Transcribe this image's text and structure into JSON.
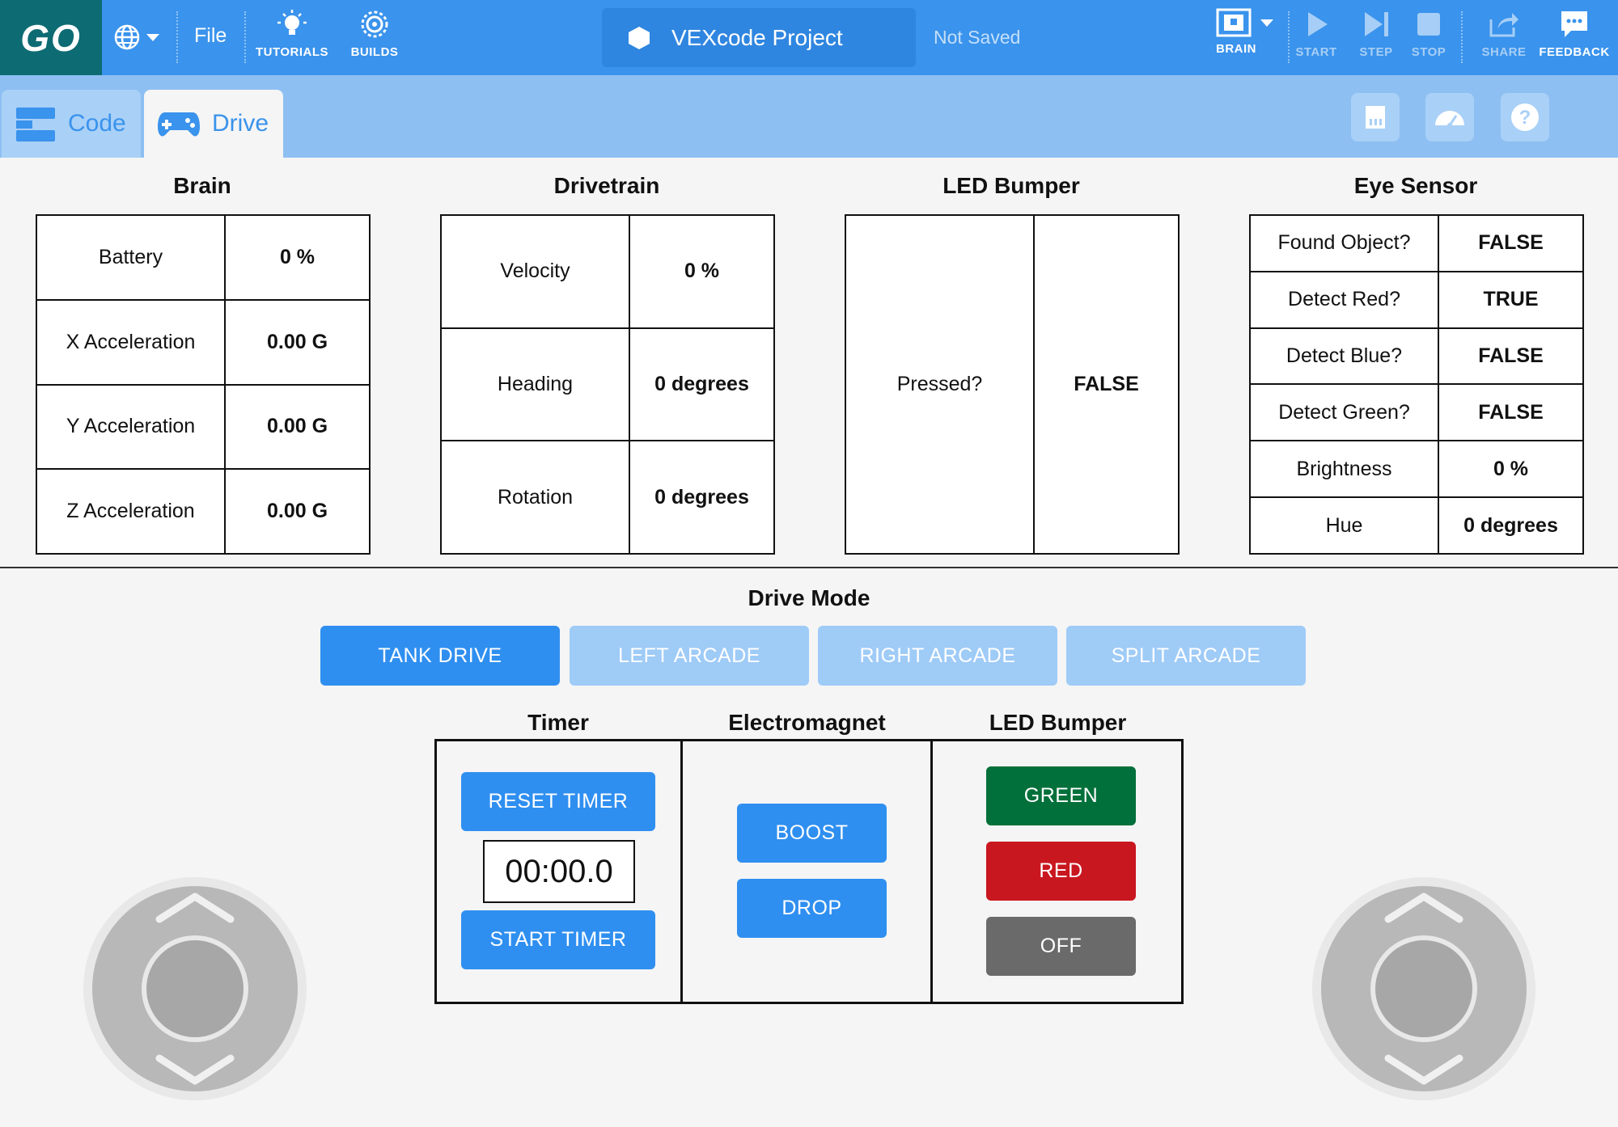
{
  "header": {
    "logo": "GO",
    "file_label": "File",
    "tutorials_label": "TUTORIALS",
    "builds_label": "BUILDS",
    "project_name": "VEXcode Project",
    "save_status": "Not Saved",
    "brain_label": "BRAIN",
    "start_label": "START",
    "step_label": "STEP",
    "stop_label": "STOP",
    "share_label": "SHARE",
    "feedback_label": "FEEDBACK"
  },
  "tabs": [
    {
      "label": "Code",
      "icon": "code-blocks-icon"
    },
    {
      "label": "Drive",
      "icon": "gamepad-icon",
      "active": true
    }
  ],
  "panels": {
    "brain": {
      "title": "Brain",
      "rows": [
        {
          "label": "Battery",
          "value": "0 %"
        },
        {
          "label": "X Acceleration",
          "value": "0.00 G"
        },
        {
          "label": "Y Acceleration",
          "value": "0.00 G"
        },
        {
          "label": "Z Acceleration",
          "value": "0.00 G"
        }
      ]
    },
    "drivetrain": {
      "title": "Drivetrain",
      "rows": [
        {
          "label": "Velocity",
          "value": "0 %"
        },
        {
          "label": "Heading",
          "value": "0 degrees"
        },
        {
          "label": "Rotation",
          "value": "0 degrees"
        }
      ]
    },
    "led_bumper": {
      "title": "LED Bumper",
      "rows": [
        {
          "label": "Pressed?",
          "value": "FALSE"
        }
      ]
    },
    "eye_sensor": {
      "title": "Eye Sensor",
      "rows": [
        {
          "label": "Found Object?",
          "value": "FALSE"
        },
        {
          "label": "Detect Red?",
          "value": "TRUE"
        },
        {
          "label": "Detect Blue?",
          "value": "FALSE"
        },
        {
          "label": "Detect Green?",
          "value": "FALSE"
        },
        {
          "label": "Brightness",
          "value": "0 %"
        },
        {
          "label": "Hue",
          "value": "0 degrees"
        }
      ]
    }
  },
  "drive_mode": {
    "title": "Drive Mode",
    "options": [
      "TANK DRIVE",
      "LEFT ARCADE",
      "RIGHT ARCADE",
      "SPLIT ARCADE"
    ],
    "selected": "TANK DRIVE"
  },
  "controls": {
    "timer": {
      "title": "Timer",
      "reset_label": "RESET TIMER",
      "display": "00:00.0",
      "start_label": "START TIMER"
    },
    "electromagnet": {
      "title": "Electromagnet",
      "boost_label": "BOOST",
      "drop_label": "DROP"
    },
    "led_bumper": {
      "title": "LED Bumper",
      "green_label": "GREEN",
      "red_label": "RED",
      "off_label": "OFF"
    }
  },
  "colors": {
    "topbar": "#3a93ec",
    "logo_bg": "#0d6b73",
    "tabbar": "#8ebff2",
    "button_blue": "#2f8ff0",
    "button_inactive": "#9fcbf7",
    "led_green": "#02703a",
    "led_red": "#c9171f",
    "led_off": "#6a6a6a"
  }
}
